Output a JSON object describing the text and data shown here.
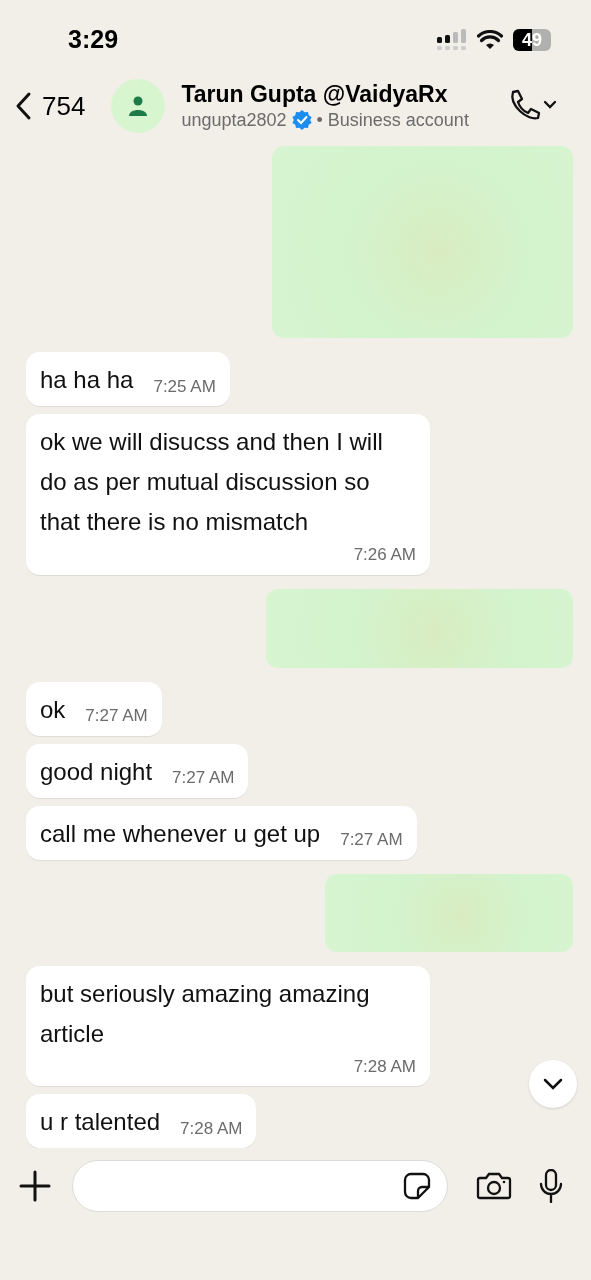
{
  "status_bar": {
    "time": "3:29",
    "battery": "49"
  },
  "header": {
    "unread_count": "754",
    "name": "Tarun Gupta @VaidyaRx",
    "username": "ungupta2802",
    "verified": true,
    "account_type": "• Business account"
  },
  "messages": [
    {
      "kind": "outgoing_hidden"
    },
    {
      "kind": "incoming",
      "text": "ha ha ha",
      "time": "7:25 AM"
    },
    {
      "kind": "incoming",
      "text": "ok we will disucss and then I will do as per mutual discussion so that there is no mismatch",
      "time": "7:26 AM"
    },
    {
      "kind": "outgoing_hidden"
    },
    {
      "kind": "incoming",
      "text": "ok",
      "time": "7:27 AM"
    },
    {
      "kind": "incoming",
      "text": "good night",
      "time": "7:27 AM"
    },
    {
      "kind": "incoming",
      "text": "call me whenever u get up",
      "time": "7:27 AM"
    },
    {
      "kind": "outgoing_hidden"
    },
    {
      "kind": "incoming",
      "text": "but seriously amazing amazing article",
      "time": "7:28 AM"
    },
    {
      "kind": "incoming",
      "text": "u r talented",
      "time": "7:28 AM"
    }
  ]
}
